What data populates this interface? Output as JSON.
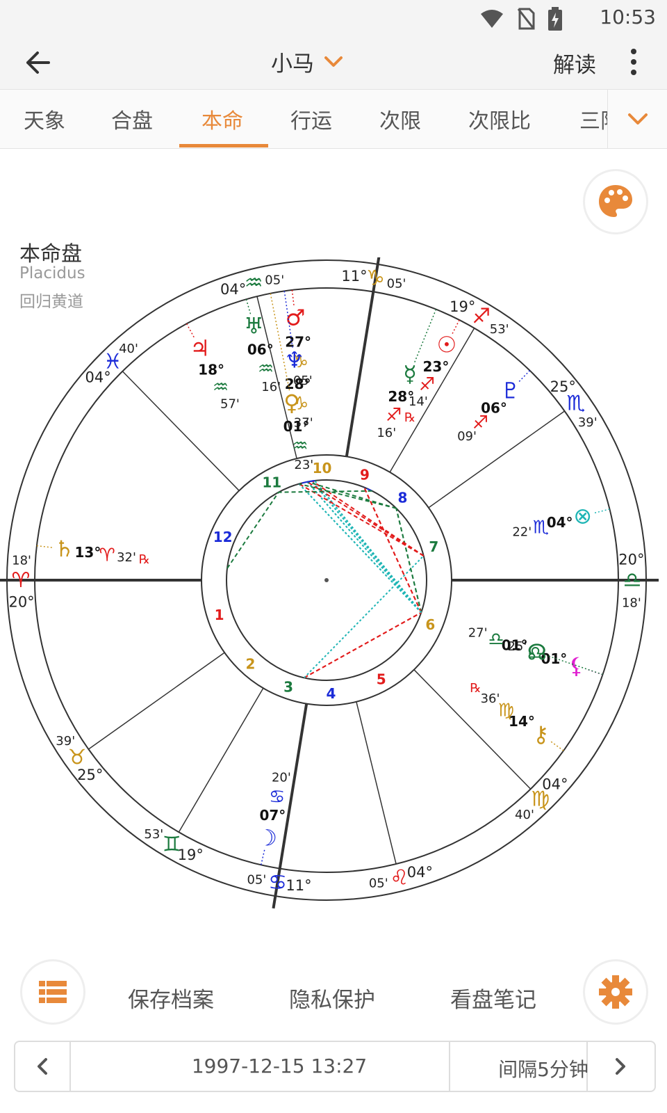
{
  "status": {
    "time": "10:53"
  },
  "appbar": {
    "title": "小马",
    "read_label": "解读"
  },
  "tabs": [
    "天象",
    "合盘",
    "本命",
    "行运",
    "次限",
    "次限比",
    "三限"
  ],
  "chart_info": {
    "title": "本命盘",
    "house_system": "Placidus",
    "zodiac": "回归黄道"
  },
  "chart_data": {
    "type": "natal-wheel",
    "ascendant": {
      "sign": "Aries",
      "deg": "20°",
      "min": "18'"
    },
    "cusps": [
      {
        "house": 1,
        "sign": "Aries",
        "deg": "20°",
        "min": "18'"
      },
      {
        "house": 2,
        "sign": "Taurus",
        "deg": "25°",
        "min": "39'"
      },
      {
        "house": 3,
        "sign": "Gemini",
        "deg": "19°",
        "min": "53'"
      },
      {
        "house": 4,
        "sign": "Cancer",
        "deg": "11°",
        "min": "05'"
      },
      {
        "house": 5,
        "sign": "Leo",
        "deg": "04°",
        "min": "05'"
      },
      {
        "house": 6,
        "sign": "Virgo",
        "deg": "04°",
        "min": "40'"
      },
      {
        "house": 7,
        "sign": "Libra",
        "deg": "20°",
        "min": "18'"
      },
      {
        "house": 8,
        "sign": "Scorpio",
        "deg": "25°",
        "min": "39'"
      },
      {
        "house": 9,
        "sign": "Sagittarius",
        "deg": "19°",
        "min": "53'"
      },
      {
        "house": 10,
        "sign": "Capricorn",
        "deg": "11°",
        "min": "05'"
      },
      {
        "house": 11,
        "sign": "Aquarius",
        "deg": "04°",
        "min": "05'"
      },
      {
        "house": 12,
        "sign": "Pisces",
        "deg": "04°",
        "min": "40'"
      }
    ],
    "planets": [
      {
        "name": "Sun",
        "deg": "23°",
        "min": "14'",
        "sign": "Sagittarius",
        "retro": true
      },
      {
        "name": "Moon",
        "deg": "07°",
        "min": "20'",
        "sign": "Cancer"
      },
      {
        "name": "Mercury",
        "deg": "28°",
        "min": "16'",
        "sign": "Sagittarius"
      },
      {
        "name": "Venus",
        "deg": "01°",
        "min": "23'",
        "sign": "Aquarius"
      },
      {
        "name": "Mars",
        "deg": "27°",
        "min": "05'",
        "sign": "Capricorn"
      },
      {
        "name": "Jupiter",
        "deg": "18°",
        "min": "57'",
        "sign": "Aquarius"
      },
      {
        "name": "Saturn",
        "deg": "13°",
        "min": "32'",
        "sign": "Aries",
        "retro": true
      },
      {
        "name": "Uranus",
        "deg": "06°",
        "min": "16'",
        "sign": "Aquarius"
      },
      {
        "name": "Neptune",
        "deg": "28°",
        "min": "37'",
        "sign": "Capricorn"
      },
      {
        "name": "Pluto",
        "deg": "06°",
        "min": "09'",
        "sign": "Sagittarius"
      },
      {
        "name": "North Node",
        "deg": "01°",
        "min": "27'",
        "sign": "Libra"
      },
      {
        "name": "Part of Fortune",
        "deg": "04°",
        "min": "22'",
        "sign": "Scorpio"
      },
      {
        "name": "Chiron",
        "deg": "14°",
        "min": "36'",
        "sign": "Virgo",
        "retro": true
      },
      {
        "name": "Lilith",
        "deg": "01°",
        "min": "25'",
        "sign": "Libra"
      }
    ],
    "house_numbers": [
      "1",
      "2",
      "3",
      "4",
      "5",
      "6",
      "7",
      "8",
      "9",
      "10",
      "11",
      "12"
    ]
  },
  "bottom_actions": {
    "save": "保存档案",
    "privacy": "隐私保护",
    "notes": "看盘笔记"
  },
  "date_bar": {
    "datetime": "1997-12-15 13:27",
    "interval": "间隔5分钟"
  },
  "colors": {
    "accent": "#e8893a"
  }
}
